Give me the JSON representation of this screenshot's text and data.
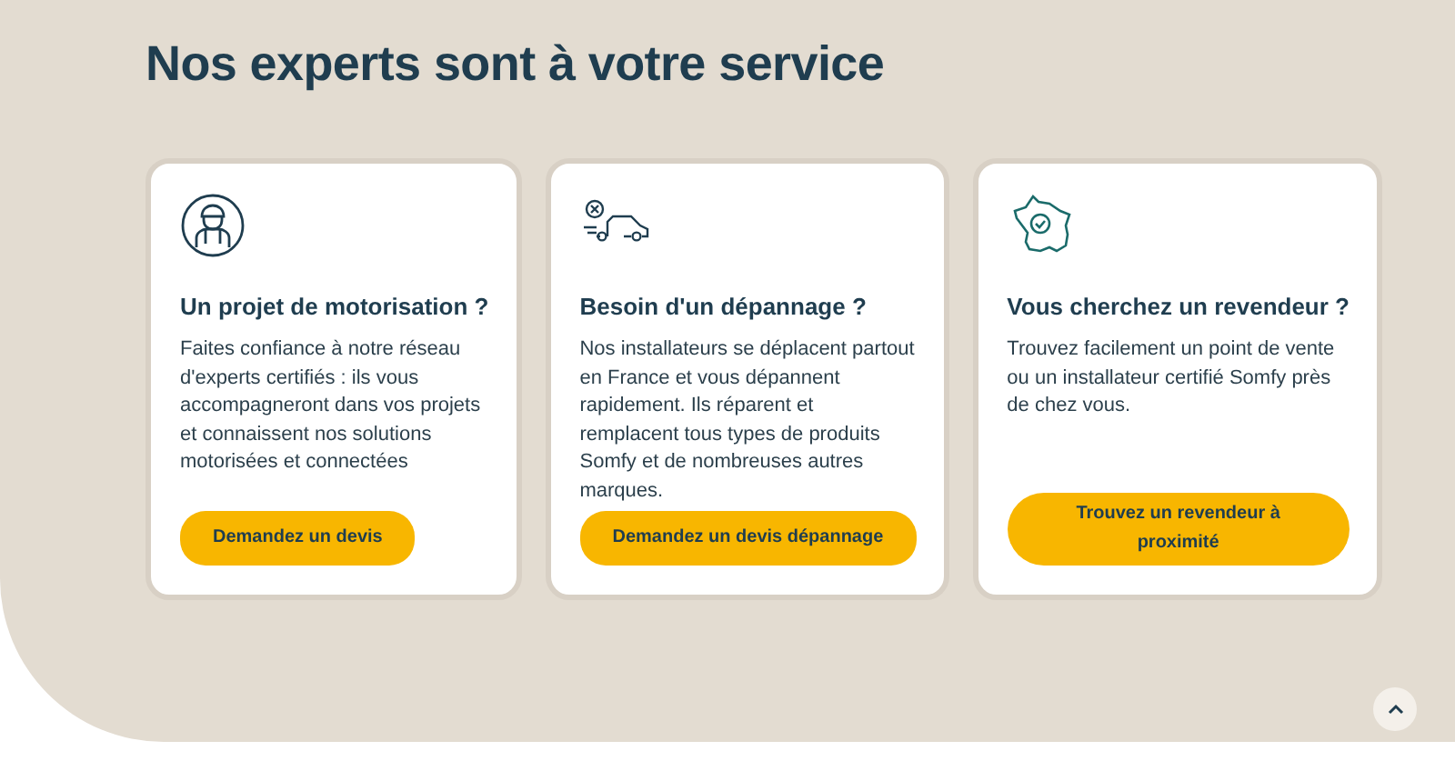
{
  "title": "Nos experts sont à votre service",
  "cards": [
    {
      "heading": "Un projet de motorisation ?",
      "text": "Faites confiance à notre réseau d'experts certifiés : ils vous accompagneront dans vos projets et connaissent nos solutions motorisées et connectées",
      "button": "Demandez un devis"
    },
    {
      "heading": "Besoin d'un dépannage ?",
      "text": "Nos installateurs se déplacent partout en France et vous dépannent rapidement. Ils réparent et remplacent tous types de produits Somfy et de nombreuses autres marques.",
      "button": "Demandez un devis dépannage"
    },
    {
      "heading": "Vous cherchez un revendeur ?",
      "text": "Trouvez facilement un point de vente ou un installateur certifié Somfy près de chez vous.",
      "button": "Trouvez un revendeur à proximité"
    }
  ]
}
